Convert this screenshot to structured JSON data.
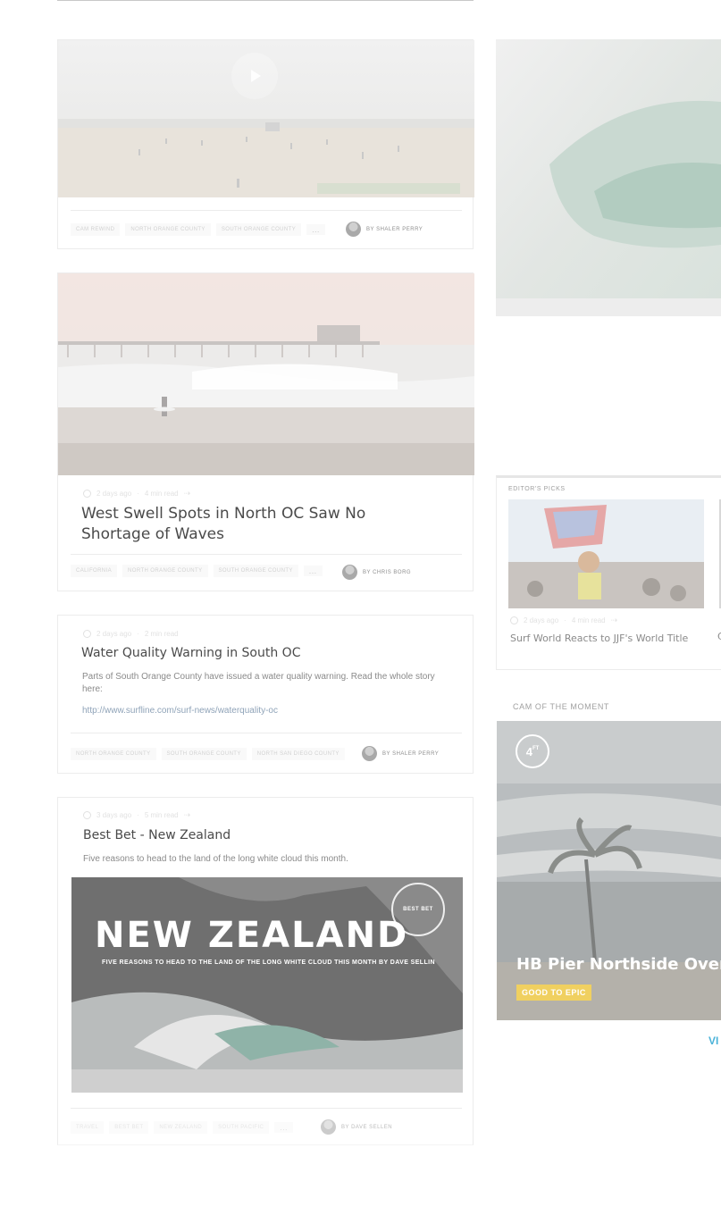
{
  "feed": {
    "card1": {
      "tags": [
        "CAM REWIND",
        "NORTH ORANGE COUNTY",
        "SOUTH ORANGE COUNTY",
        "..."
      ],
      "author": "BY SHALER PERRY"
    },
    "card2": {
      "age": "2 days ago",
      "read": "4 min read",
      "title": "West Swell Spots in North OC Saw No Shortage of Waves",
      "tags": [
        "CALIFORNIA",
        "NORTH ORANGE COUNTY",
        "SOUTH ORANGE COUNTY",
        "..."
      ],
      "author": "BY CHRIS BORG"
    },
    "card3": {
      "age": "2 days ago",
      "read": "2 min read",
      "title": "Water Quality Warning in South OC",
      "body": "Parts of South Orange County have issued a water quality warning.  Read the whole story here:",
      "link": "http://www.surfline.com/surf-news/waterquality-oc",
      "tags": [
        "NORTH ORANGE COUNTY",
        "SOUTH ORANGE COUNTY",
        "NORTH SAN DIEGO COUNTY"
      ],
      "author": "BY SHALER PERRY"
    },
    "card4": {
      "age": "3 days ago",
      "read": "5 min read",
      "title": "Best Bet - New Zealand",
      "body": "Five reasons to head to the land of the long white cloud this month.",
      "image_headline": "NEW ZEALAND",
      "image_subline": "FIVE REASONS TO HEAD TO THE LAND OF THE LONG WHITE CLOUD THIS MONTH BY DAVE SELLIN",
      "image_logo": "BEST BET",
      "tags": [
        "TRAVEL",
        "BEST BET",
        "NEW ZEALAND",
        "SOUTH PACIFIC",
        "..."
      ],
      "author": "BY DAVE SELLEN"
    }
  },
  "sidebar": {
    "editors_picks": {
      "label": "EDITOR'S PICKS",
      "item": {
        "age": "2 days ago",
        "read": "4 min read",
        "title": "Surf World Reacts to JJF's World Title"
      },
      "next_item_initial": "C"
    },
    "cam": {
      "label": "CAM OF THE MOMENT",
      "height": "4",
      "height_unit": "FT",
      "title": "HB Pier Northside Overv",
      "condition": "GOOD TO EPIC",
      "condition_color": "#f0d060"
    },
    "view_all": "VI"
  }
}
